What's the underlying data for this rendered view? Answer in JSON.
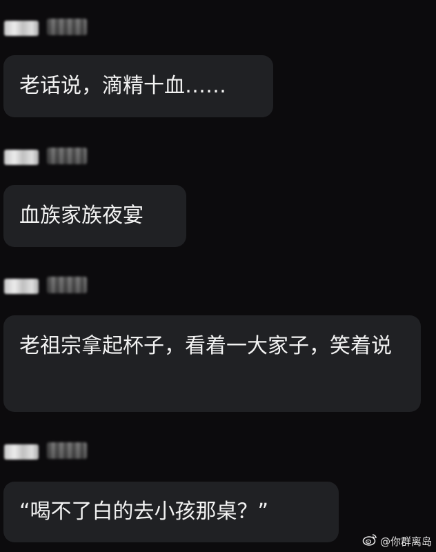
{
  "messages": [
    {
      "text": "老话说，滴精十血……"
    },
    {
      "text": "血族家族夜宴"
    },
    {
      "text": "老祖宗拿起杯子，看着一大家子，笑着说"
    },
    {
      "text": "“喝不了白的去小孩那桌？”"
    }
  ],
  "watermark": {
    "icon": "weibo-icon",
    "text": "@你群离岛"
  }
}
